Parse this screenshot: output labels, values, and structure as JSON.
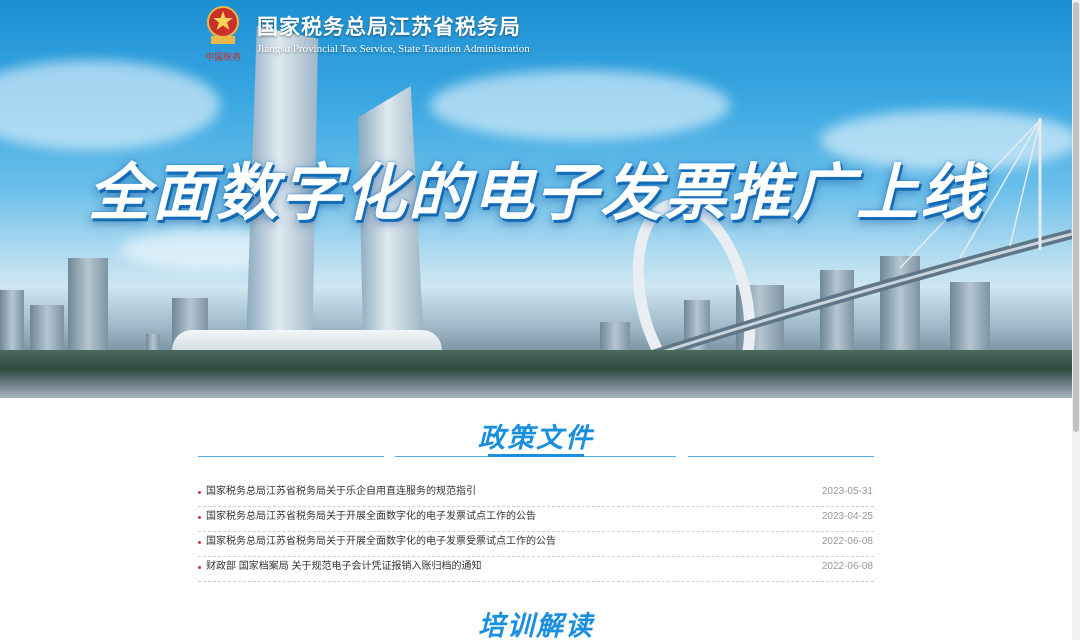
{
  "header": {
    "title": "国家税务总局江苏省税务局",
    "subtitle": "Jiangsu Provincial Tax Service, State Taxation Administration",
    "emblem_caption": "中国税务"
  },
  "banner": {
    "headline": "全面数字化的电子发票推广上线"
  },
  "policy": {
    "title": "政策文件",
    "items": [
      {
        "title": "国家税务总局江苏省税务局关于乐企自用直连服务的规范指引",
        "date": "2023-05-31"
      },
      {
        "title": "国家税务总局江苏省税务局关于开展全面数字化的电子发票试点工作的公告",
        "date": "2023-04-25"
      },
      {
        "title": "国家税务总局江苏省税务局关于开展全面数字化的电子发票受票试点工作的公告",
        "date": "2022-06-08"
      },
      {
        "title": "财政部 国家档案局 关于规范电子会计凭证报销入账归档的通知",
        "date": "2022-06-08"
      }
    ]
  },
  "training": {
    "title": "培训解读"
  },
  "colors": {
    "accent": "#1a8fe0",
    "bullet": "#d4343a"
  }
}
